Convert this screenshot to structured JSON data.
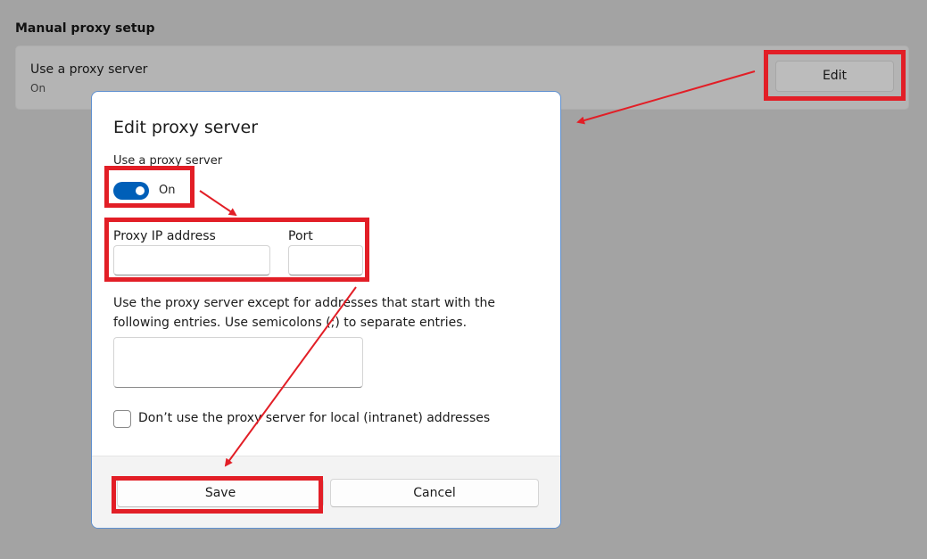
{
  "background": {
    "section_title": "Manual proxy setup",
    "card": {
      "title": "Use a proxy server",
      "status": "On",
      "edit_label": "Edit"
    }
  },
  "dialog": {
    "title": "Edit proxy server",
    "toggle": {
      "label": "Use a proxy server",
      "state": "On",
      "checked": true
    },
    "proxy_ip": {
      "label": "Proxy IP address",
      "value": ""
    },
    "port": {
      "label": "Port",
      "value": ""
    },
    "exceptions": {
      "description": "Use the proxy server except for addresses that start with the following entries. Use semicolons (;) to separate entries.",
      "value": ""
    },
    "local_checkbox": {
      "label": "Don’t use the proxy server for local (intranet) addresses",
      "checked": false
    },
    "buttons": {
      "save": "Save",
      "cancel": "Cancel"
    }
  },
  "annotations": {
    "highlight_color": "#e21e26",
    "accent_color": "#005fb8"
  }
}
